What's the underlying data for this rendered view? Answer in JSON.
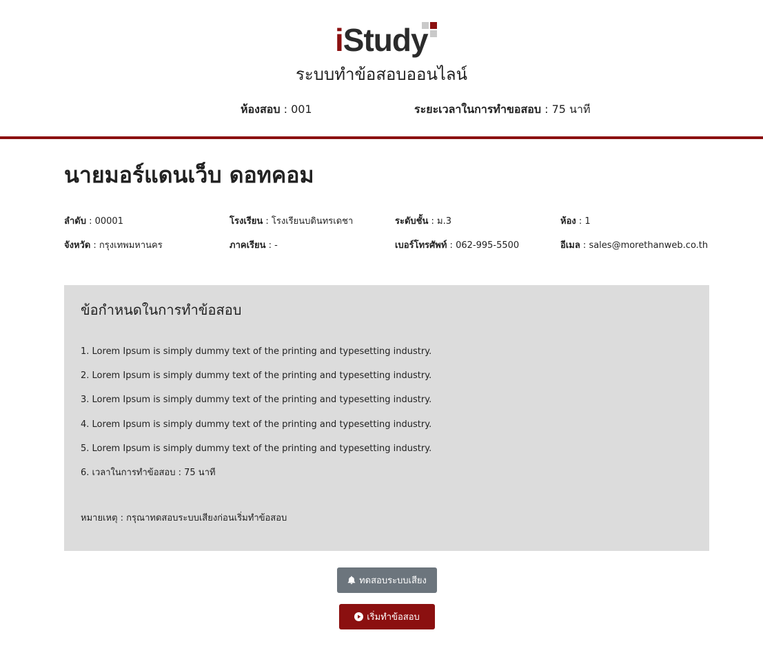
{
  "header": {
    "logo_text": "iStudy",
    "system_title": "ระบบทำข้อสอบออนไลน์",
    "room_label": "ห้องสอบ",
    "room_value": " : 001",
    "duration_label": "ระยะเวลาในการทำขอสอบ",
    "duration_value": " : 75 นาที"
  },
  "student": {
    "name": "นายมอร์แดนเว็บ ดอทคอม",
    "fields": [
      {
        "label": "ลำดับ",
        "value": " : 00001"
      },
      {
        "label": "โรงเรียน",
        "value": " : โรงเรียนบดินทรเดชา"
      },
      {
        "label": "ระดับชั้น",
        "value": " : ม.3"
      },
      {
        "label": "ห้อง",
        "value": " : 1"
      },
      {
        "label": "จังหวัด",
        "value": " : กรุงเทพมหานคร"
      },
      {
        "label": "ภาคเรียน",
        "value": " : -"
      },
      {
        "label": "เบอร์โทรศัพท์",
        "value": " : 062-995-5500"
      },
      {
        "label": "อีเมล",
        "value": " : sales@morethanweb.co.th"
      }
    ]
  },
  "rules": {
    "title": "ข้อกำหนดในการทำข้อสอบ",
    "items": [
      "1. Lorem Ipsum is simply dummy text of the printing and typesetting industry.",
      "2. Lorem Ipsum is simply dummy text of the printing and typesetting industry.",
      "3. Lorem Ipsum is simply dummy text of the printing and typesetting industry.",
      "4. Lorem Ipsum is simply dummy text of the printing and typesetting industry.",
      "5. Lorem Ipsum is simply dummy text of the printing and typesetting industry.",
      "6. เวลาในการทำข้อสอบ : 75 นาที"
    ],
    "remark": "หมายเหตุ : กรุณาทดสอบระบบเสียงก่อนเริ่มทำข้อสอบ"
  },
  "actions": {
    "test_sound_label": "ทดสอบระบบเสียง",
    "start_label": "เริ่มทำข้อสอบ"
  },
  "colors": {
    "brand": "#8b1010",
    "panel": "#dcdcdc",
    "secondary_button": "#6c757d"
  },
  "icons": {
    "test_sound": "bell-icon",
    "start": "play-circle-icon"
  }
}
